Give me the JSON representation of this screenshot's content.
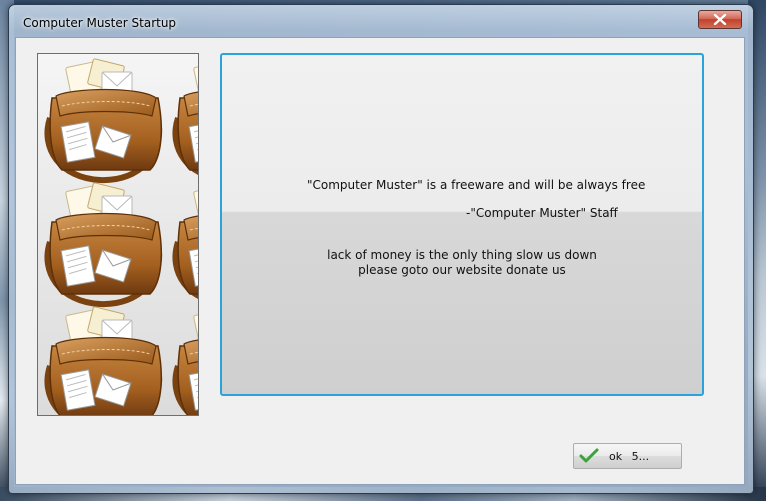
{
  "window": {
    "title": "Computer Muster Startup"
  },
  "close_icon": "close-icon",
  "message": {
    "line1": "\"Computer Muster\" is a freeware and will be always free",
    "line2": "-\"Computer Muster\" Staff",
    "line3": "lack of money is the only thing slow us down",
    "line4": "please goto our website donate us"
  },
  "ok_button": {
    "label": "ok   5...",
    "icon": "checkmark-icon",
    "icon_color": "#3aa43a"
  },
  "accent_color": "#29a3d9"
}
